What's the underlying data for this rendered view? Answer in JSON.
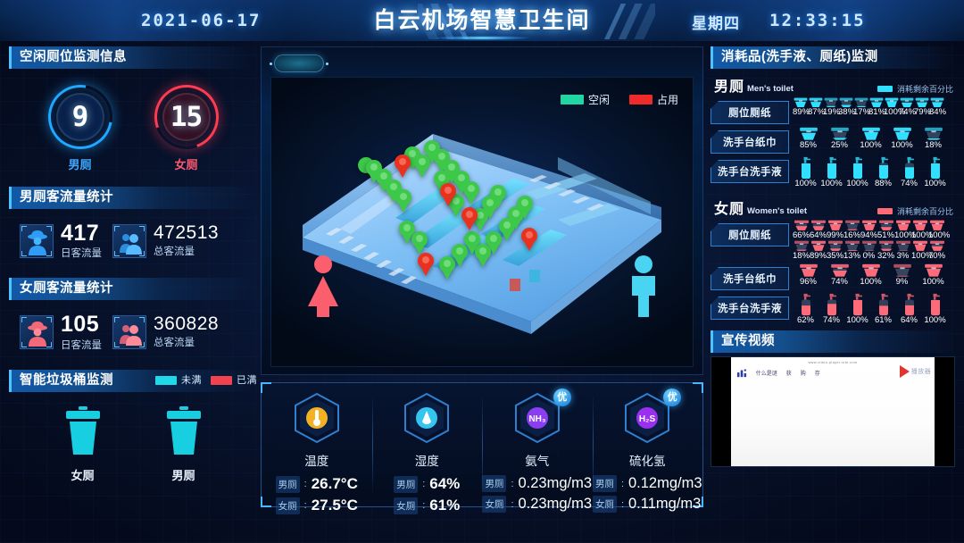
{
  "header": {
    "date": "2021-06-17",
    "title": "白云机场智慧卫生间",
    "weekday": "星期四",
    "time": "12:33:15"
  },
  "left": {
    "free_stalls": {
      "title": "空闲厕位监测信息",
      "items": [
        {
          "value": "9",
          "label": "男厕",
          "color": "#1fa8ff"
        },
        {
          "value": "15",
          "label": "女厕",
          "color": "#ff3b52"
        }
      ]
    },
    "male_flow": {
      "title": "男厕客流量统计",
      "daily_value": "417",
      "daily_label": "日客流量",
      "total_value": "472513",
      "total_label": "总客流量"
    },
    "female_flow": {
      "title": "女厕客流量统计",
      "daily_value": "105",
      "daily_label": "日客流量",
      "total_value": "360828",
      "total_label": "总客流量"
    },
    "bins": {
      "title": "智能垃圾桶监测",
      "legend": [
        {
          "label": "未满",
          "color": "#1fd8e8"
        },
        {
          "label": "已满",
          "color": "#f0434f"
        }
      ],
      "items": [
        {
          "label": "女厕",
          "status": "未满",
          "color": "#1fd8e8"
        },
        {
          "label": "男厕",
          "status": "未满",
          "color": "#1fd8e8"
        }
      ]
    }
  },
  "center": {
    "legend": [
      {
        "label": "空闲",
        "color": "#22d6a4"
      },
      {
        "label": "占用",
        "color": "#ef2a2a"
      }
    ],
    "floorplan": {
      "free_pin_color": "#3dc84a",
      "occupied_pin_color": "#e8321f",
      "free_pins": 26,
      "occupied_pins": 5,
      "female_icon_color": "#fb5f6e",
      "male_icon_color": "#49d4f2"
    },
    "environment": [
      {
        "name": "温度",
        "icon": "thermometer-icon",
        "icon_color": "#f4b223",
        "grade": null,
        "rows": [
          {
            "key": "男厕",
            "value": "26.7°C"
          },
          {
            "key": "女厕",
            "value": "27.5°C"
          }
        ]
      },
      {
        "name": "湿度",
        "icon": "humidity-icon",
        "icon_color": "#35c6f0",
        "grade": null,
        "rows": [
          {
            "key": "男厕",
            "value": "64%"
          },
          {
            "key": "女厕",
            "value": "61%"
          }
        ]
      },
      {
        "name": "氨气",
        "icon": "NH₃",
        "icon_color": "#8b3df0",
        "grade": "优",
        "rows": [
          {
            "key": "男厕",
            "value": "0.23mg/m3"
          },
          {
            "key": "女厕",
            "value": "0.23mg/m3"
          }
        ]
      },
      {
        "name": "硫化氢",
        "icon": "H₂S",
        "icon_color": "#9b2ff0",
        "grade": "优",
        "rows": [
          {
            "key": "男厕",
            "value": "0.12mg/m3"
          },
          {
            "key": "女厕",
            "value": "0.11mg/m3"
          }
        ]
      }
    ]
  },
  "right": {
    "consumables": {
      "title": "消耗品(洗手液、厕纸)监测",
      "legend_label": "消耗剩余百分比",
      "mens": {
        "name_cn": "男厕",
        "name_en": "Men's toilet",
        "color": "#2fe0ff",
        "rows": [
          {
            "label": "厕位厕纸",
            "icon": "toilet-paper-icon",
            "lines": [
              [
                "89%",
                "87%",
                "19%",
                "38%",
                "17%",
                "81%",
                "100%",
                "74%",
                "79%",
                "84%"
              ]
            ]
          },
          {
            "label": "洗手台纸巾",
            "icon": "tissue-icon",
            "lines": [
              [
                "85%",
                "25%",
                "100%",
                "100%",
                "18%"
              ]
            ]
          },
          {
            "label": "洗手台洗手液",
            "icon": "soap-icon",
            "lines": [
              [
                "100%",
                "100%",
                "100%",
                "88%",
                "74%",
                "100%"
              ]
            ]
          }
        ]
      },
      "womens": {
        "name_cn": "女厕",
        "name_en": "Women's toilet",
        "color": "#ff6a78",
        "rows": [
          {
            "label": "厕位厕纸",
            "icon": "toilet-paper-icon",
            "lines": [
              [
                "66%",
                "64%",
                "99%",
                "16%",
                "94%",
                "51%",
                "100%",
                "100%",
                "100%"
              ],
              [
                "18%",
                "89%",
                "35%",
                "13%",
                "0%",
                "32%",
                "3%",
                "100%",
                "70%"
              ]
            ]
          },
          {
            "label": "洗手台纸巾",
            "icon": "tissue-icon",
            "lines": [
              [
                "96%",
                "74%",
                "100%",
                "9%",
                "100%"
              ]
            ]
          },
          {
            "label": "洗手台洗手液",
            "icon": "soap-icon",
            "lines": [
              [
                "62%",
                "74%",
                "100%",
                "61%",
                "64%",
                "100%"
              ]
            ]
          }
        ]
      }
    },
    "video": {
      "title": "宣传视频",
      "url_text": "www.video-player-site.com",
      "nav_links": [
        "什么是谜",
        "获",
        "购",
        "存"
      ],
      "brand": "播放器"
    }
  }
}
